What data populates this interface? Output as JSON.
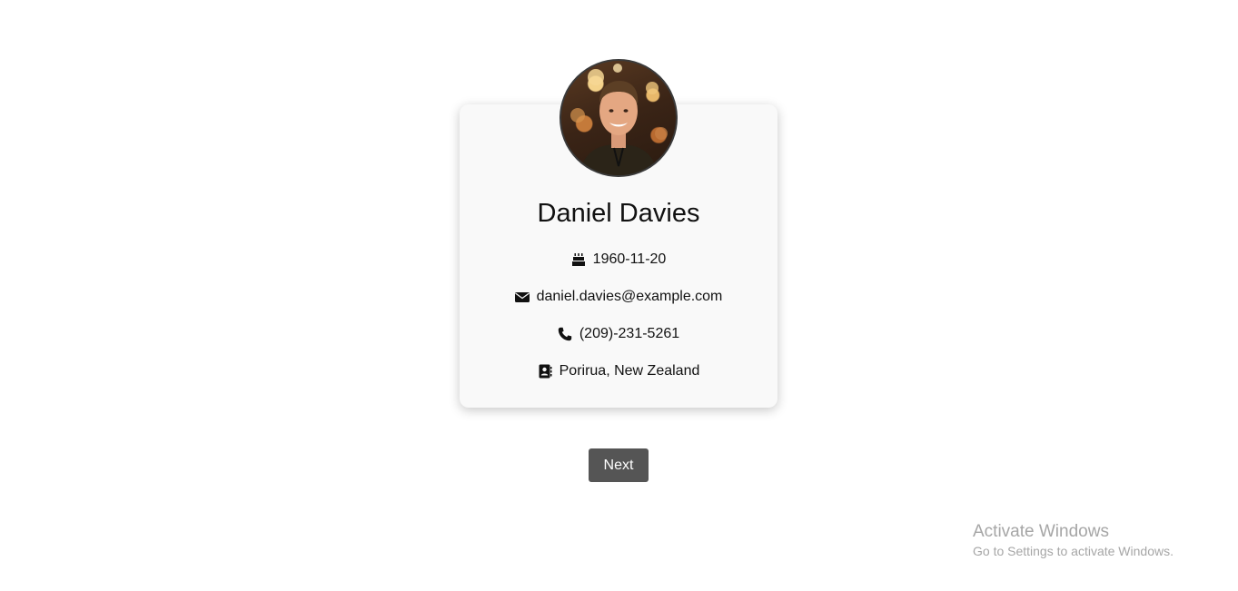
{
  "profile": {
    "name": "Daniel Davies",
    "birth_date": "1960-11-20",
    "email": "daniel.davies@example.com",
    "phone": "(209)-231-5261",
    "location": "Porirua, New Zealand"
  },
  "icons": {
    "dob": "birthday-cake-icon",
    "email": "envelope-icon",
    "phone": "phone-icon",
    "location": "address-book-icon"
  },
  "actions": {
    "next_label": "Next"
  },
  "watermark": {
    "title": "Activate Windows",
    "subtitle": "Go to Settings to activate Windows."
  },
  "colors": {
    "card_background": "#f9f9f9",
    "button_background": "#555555",
    "button_text": "#ffffff",
    "watermark_text": "#a6a6a6"
  }
}
